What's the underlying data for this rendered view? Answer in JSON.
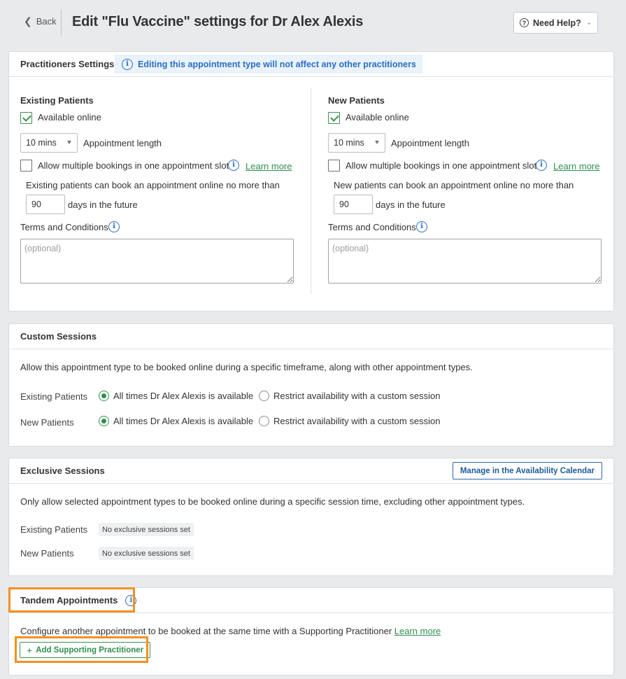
{
  "header": {
    "back_label": "Back",
    "title": "Edit \"Flu Vaccine\" settings for Dr Alex Alexis",
    "help_label": "Need Help?"
  },
  "practitioners_settings": {
    "title": "Practitioners Settings",
    "notice": "Editing this appointment type will not affect any other practitioners",
    "existing": {
      "title": "Existing Patients",
      "available_online_label": "Available online",
      "available_online_checked": true,
      "length_value": "10 mins",
      "length_label": "Appointment length",
      "multiple_bookings_label": "Allow multiple bookings in one appointment slot",
      "multiple_bookings_checked": false,
      "learn_more": "Learn more",
      "advance_text": "Existing patients can book an appointment online no more than",
      "days_value": "90",
      "days_label": "days in the future",
      "terms_label": "Terms and Conditions",
      "terms_placeholder": "(optional)"
    },
    "new": {
      "title": "New Patients",
      "available_online_label": "Available online",
      "available_online_checked": true,
      "length_value": "10 mins",
      "length_label": "Appointment length",
      "multiple_bookings_label": "Allow multiple bookings in one appointment slot",
      "multiple_bookings_checked": false,
      "learn_more": "Learn more",
      "advance_text": "New patients can book an appointment online no more than",
      "days_value": "90",
      "days_label": "days in the future",
      "terms_label": "Terms and Conditions",
      "terms_placeholder": "(optional)"
    }
  },
  "custom_sessions": {
    "title": "Custom Sessions",
    "description": "Allow this appointment type to be booked online during a specific timeframe, along with other appointment types.",
    "existing_label": "Existing Patients",
    "new_label": "New Patients",
    "option_all": "All times Dr Alex Alexis is available",
    "option_restrict": "Restrict availability with a custom session",
    "existing_selected": "all",
    "new_selected": "all"
  },
  "exclusive_sessions": {
    "title": "Exclusive Sessions",
    "manage_label": "Manage in the Availability Calendar",
    "description": "Only allow selected appointment types to be booked online during a specific session time, excluding other appointment types.",
    "existing_label": "Existing Patients",
    "new_label": "New Patients",
    "existing_value": "No exclusive sessions set",
    "new_value": "No exclusive sessions set"
  },
  "tandem": {
    "title": "Tandem Appointments",
    "description": "Configure another appointment to be booked at the same time with a Supporting Practitioner",
    "learn_more": "Learn more",
    "add_label": "Add Supporting Practitioner"
  },
  "colors": {
    "accent_green": "#2f8f4f",
    "info_blue": "#2a6fc4",
    "highlight_orange": "#f68f1f",
    "page_bg": "#e9eaec"
  }
}
